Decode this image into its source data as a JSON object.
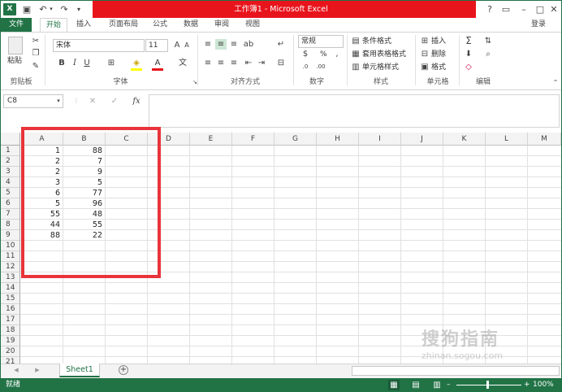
{
  "title": "工作簿1 - Microsoft Excel",
  "login": "登录",
  "tabs": [
    "文件",
    "开始",
    "插入",
    "页面布局",
    "公式",
    "数据",
    "审阅",
    "视图"
  ],
  "clipboard": {
    "paste": "粘贴",
    "label": "剪贴板"
  },
  "font": {
    "name": "宋体",
    "size": "11",
    "label": "字体",
    "bold": "B",
    "italic": "I",
    "underline": "U"
  },
  "alignment": {
    "label": "对齐方式"
  },
  "number": {
    "format": "常规",
    "label": "数字",
    "percent": "%"
  },
  "styles": {
    "cond": "条件格式",
    "table": "套用表格格式",
    "cell": "单元格样式",
    "label": "样式"
  },
  "cells": {
    "insert": "插入",
    "delete": "删除",
    "format": "格式",
    "label": "单元格"
  },
  "editing": {
    "label": "编辑",
    "sigma": "Σ"
  },
  "namebox": "C8",
  "fx": "fx",
  "columns": [
    "A",
    "B",
    "C",
    "D",
    "E",
    "F",
    "G",
    "H",
    "I",
    "J",
    "K",
    "L",
    "M"
  ],
  "rows": [
    "1",
    "2",
    "3",
    "4",
    "5",
    "6",
    "7",
    "8",
    "9",
    "10",
    "11",
    "12",
    "13",
    "14",
    "15",
    "16",
    "17",
    "18",
    "19",
    "20",
    "21"
  ],
  "data_a": [
    "1",
    "2",
    "2",
    "3",
    "6",
    "5",
    "55",
    "44",
    "88"
  ],
  "data_b": [
    "88",
    "7",
    "9",
    "5",
    "77",
    "96",
    "48",
    "55",
    "22"
  ],
  "sheet": "Sheet1",
  "status": "就绪",
  "zoom": "100%",
  "watermark": {
    "text1": "搜狗指南",
    "text2": "zhinan.sogou.com"
  }
}
